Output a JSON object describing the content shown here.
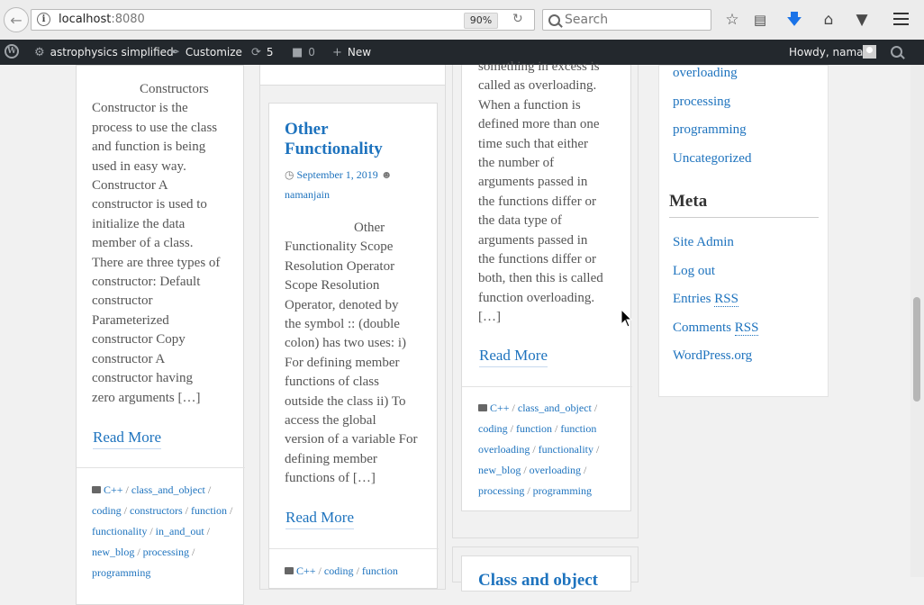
{
  "browser": {
    "url_host": "localhost",
    "url_port": ":8080",
    "zoom": "90%",
    "search_placeholder": "Search"
  },
  "admin_bar": {
    "site_name": "astrophysics simplified",
    "customize": "Customize",
    "updates_count": "5",
    "comments_count": "0",
    "new_label": "New",
    "howdy": "Howdy, naman"
  },
  "col1": {
    "excerpt_lines": [
      "Constructors",
      "Constructor is the",
      "process to use the class",
      "and function is being",
      "used in easy way.",
      "Constructor A",
      "constructor is used to",
      "initialize the data",
      "member of a class.",
      "There are three types of",
      "constructor: Default",
      "constructor",
      "Parameterized",
      "constructor Copy",
      "constructor A",
      "constructor having",
      "zero arguments […]"
    ],
    "read_more": "Read More",
    "tags": [
      "C++",
      "class_and_object",
      "coding",
      "constructors",
      "function",
      "functionality",
      "in_and_out",
      "new_blog",
      "processing",
      "programming"
    ]
  },
  "col2": {
    "title_lines": [
      "Other",
      "Functionality"
    ],
    "date": "September 1, 2019",
    "author": "namanjain",
    "excerpt_lines": [
      "Other",
      "Functionality Scope",
      "Resolution Operator",
      "Scope Resolution",
      "Operator, denoted by",
      "the symbol :: (double",
      "colon) has two uses: i)",
      "For defining member",
      "functions of class",
      "outside the class ii) To",
      "access the global",
      "version of a variable For",
      "defining member",
      "functions of […]"
    ],
    "read_more": "Read More",
    "tags": [
      "C++",
      "coding",
      "function"
    ]
  },
  "col3": {
    "excerpt_lines": [
      "something in excess is",
      "called as overloading.",
      "When a function is",
      "defined more than one",
      "time such that either",
      "the number of",
      "arguments passed in",
      "the functions differ or",
      "the data type of",
      "arguments passed in",
      "the functions differ or",
      "both, then this is called",
      "function overloading.",
      "[…]"
    ],
    "read_more": "Read More",
    "tags": [
      "C++",
      "class_and_object",
      "coding",
      "function",
      "function overloading",
      "functionality",
      "new_blog",
      "overloading",
      "processing",
      "programming"
    ],
    "next_title": "Class and object"
  },
  "sidebar": {
    "categories": [
      "overloading",
      "processing",
      "programming",
      "Uncategorized"
    ],
    "meta_heading": "Meta",
    "site_admin": "Site Admin",
    "log_out": "Log out",
    "entries": "Entries",
    "comments": "Comments",
    "rss": "RSS",
    "wordpress": "WordPress.org"
  },
  "colors": {
    "link": "#1e73be",
    "admin_bar": "#23282d"
  }
}
